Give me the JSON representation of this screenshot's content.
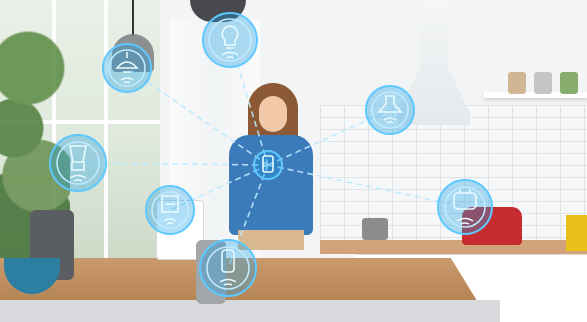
{
  "scene": {
    "subject": "woman-with-smartphone",
    "theme_colors": {
      "node_glow": "#5ec8ff",
      "link": "#bde9ff",
      "wall": "#f2f4f5",
      "island_wood": "#b88758"
    }
  },
  "network": {
    "hub": {
      "id": "phone",
      "icon": "smartphone-icon"
    },
    "nodes": [
      {
        "id": "pendant-lamp-left",
        "icon": "pendant-lamp-icon"
      },
      {
        "id": "ceiling-bulb",
        "icon": "light-bulb-icon"
      },
      {
        "id": "range-hood",
        "icon": "range-hood-icon"
      },
      {
        "id": "blender",
        "icon": "blender-icon"
      },
      {
        "id": "coffee-maker",
        "icon": "coffee-maker-icon"
      },
      {
        "id": "smart-speaker",
        "icon": "smart-speaker-icon"
      },
      {
        "id": "toaster",
        "icon": "toaster-icon"
      }
    ]
  }
}
